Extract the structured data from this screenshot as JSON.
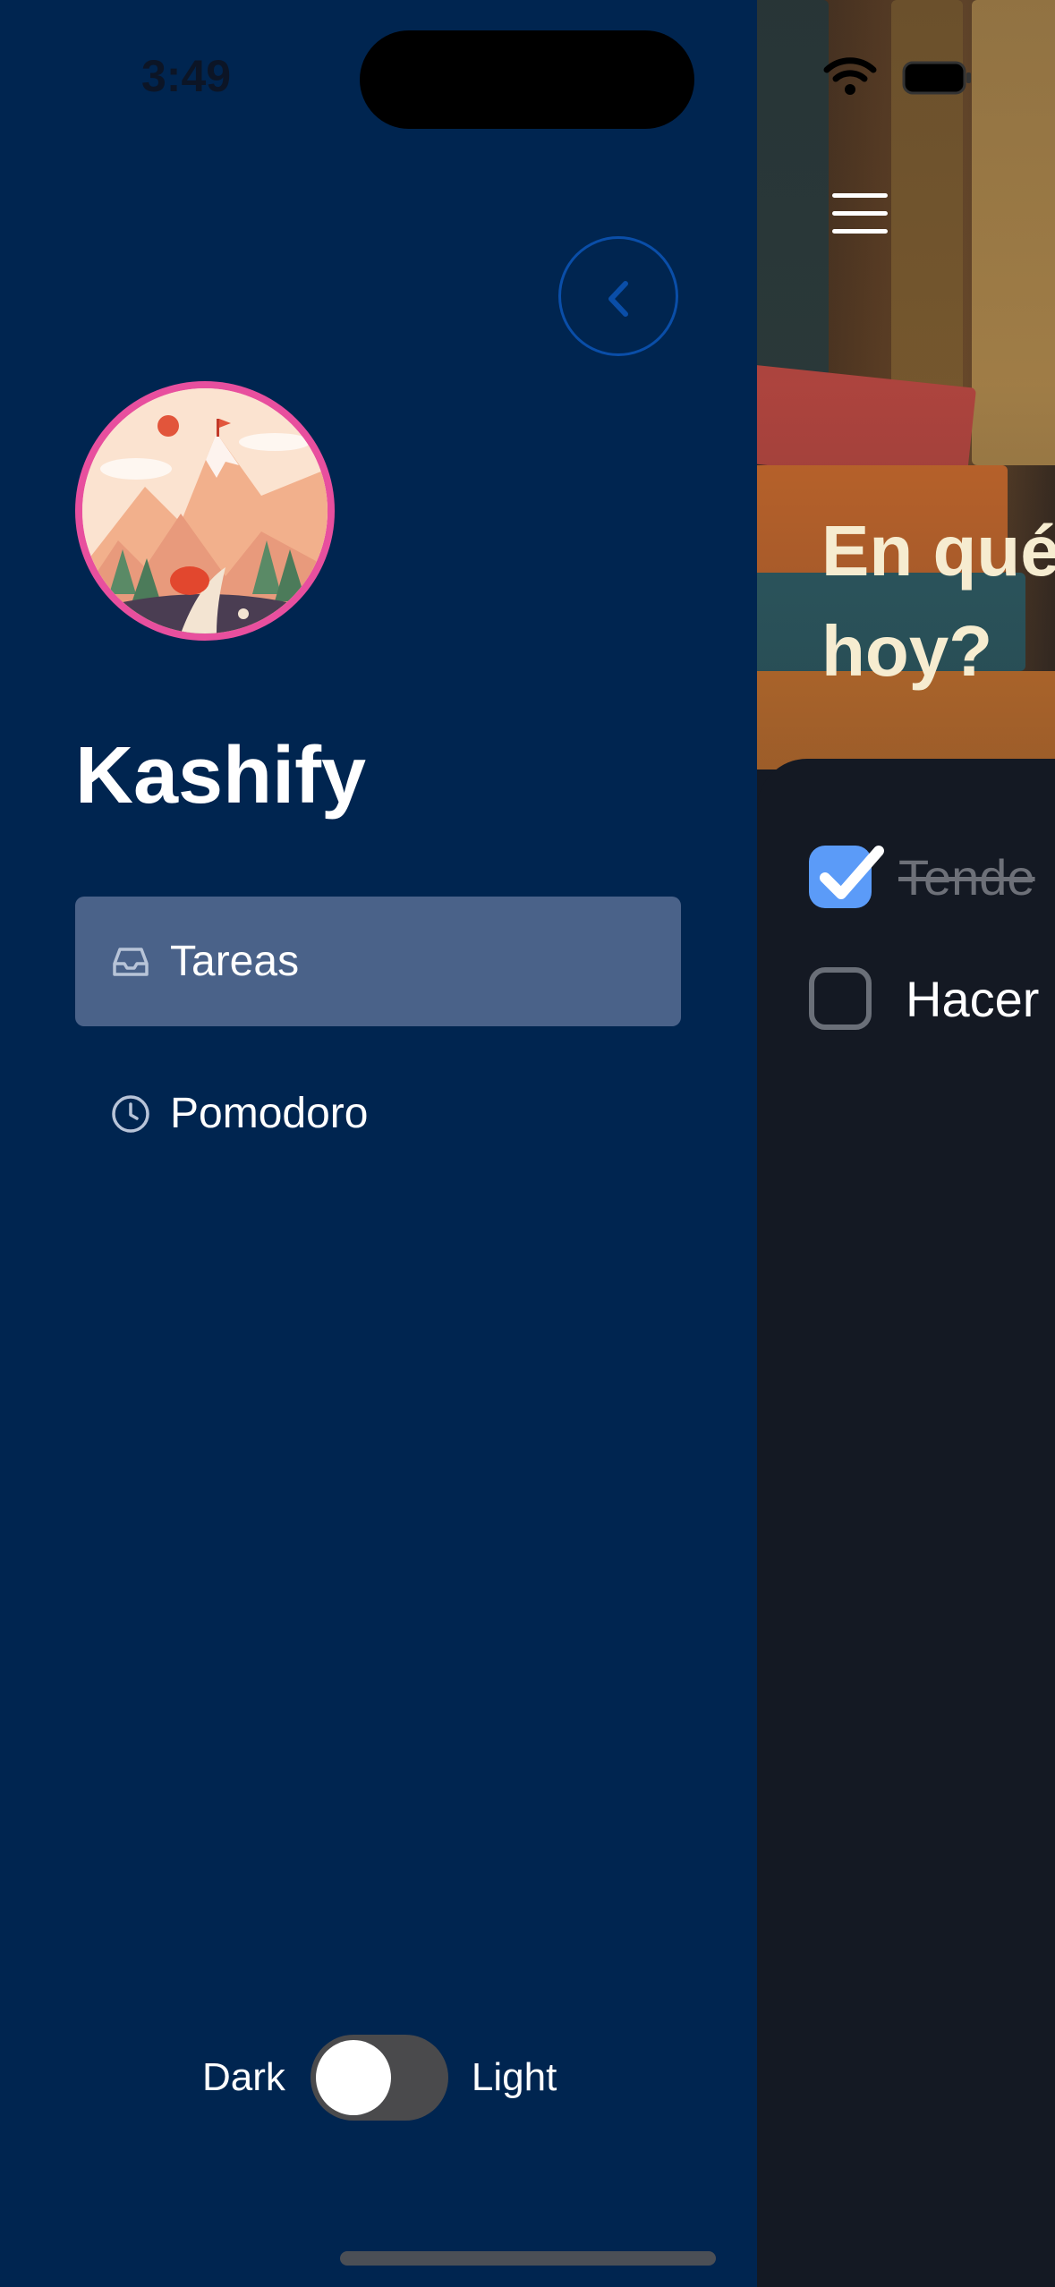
{
  "status_bar": {
    "time": "3:49"
  },
  "drawer": {
    "app_name": "Kashify",
    "nav": [
      {
        "label": "Tareas",
        "icon": "inbox-icon",
        "active": true
      },
      {
        "label": "Pomodoro",
        "icon": "clock-icon",
        "active": false
      }
    ],
    "theme": {
      "dark_label": "Dark",
      "light_label": "Light",
      "light_mode": false
    }
  },
  "main": {
    "heading": "En qué\nhoy?",
    "tasks": [
      {
        "text": "Tende",
        "done": true
      },
      {
        "text": "Hacer",
        "done": false
      }
    ]
  },
  "colors": {
    "drawer_bg": "#002550",
    "active_item_bg": "#4a6289",
    "accent": "#5b9bf8",
    "avatar_border": "#e84f9e"
  }
}
